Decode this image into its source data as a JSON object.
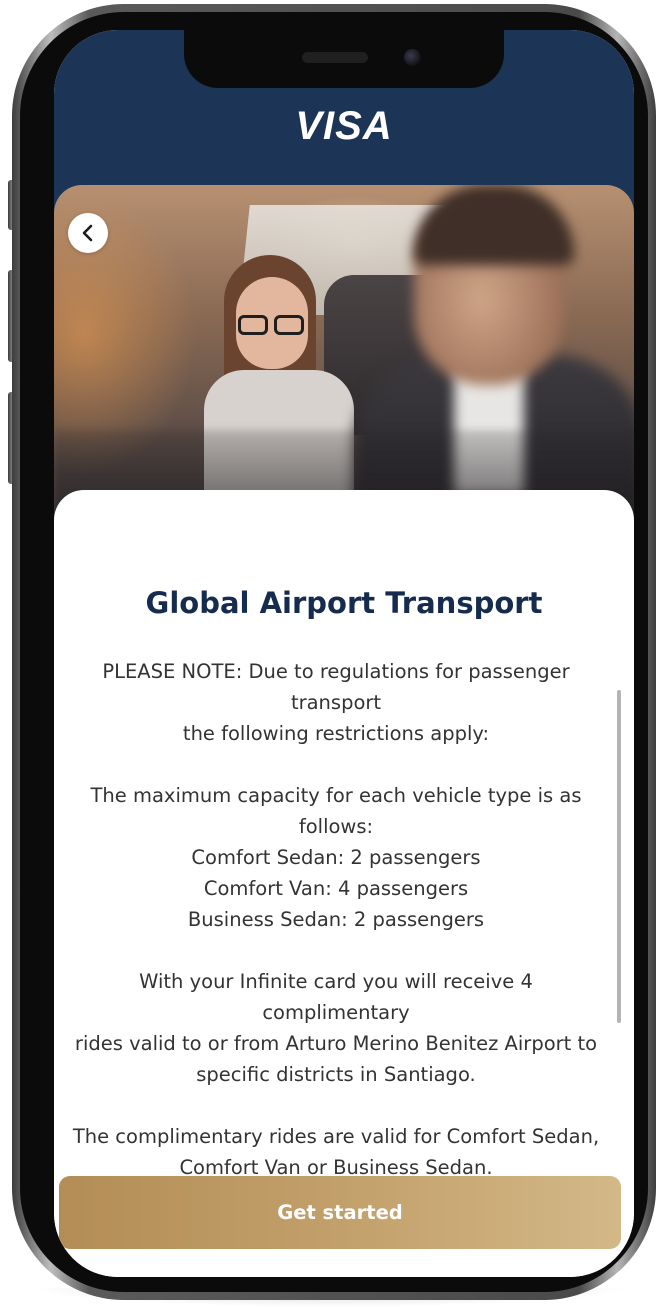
{
  "header": {
    "logo": "VISA",
    "brand_color": "#1c3557"
  },
  "hero": {
    "back_icon": "chevron-left-icon"
  },
  "content": {
    "title": "Global Airport Transport",
    "notice": [
      "PLEASE NOTE: Due to regulations for passenger transport",
      "the following restrictions apply:"
    ],
    "capacity": [
      "The maximum capacity for each vehicle type is as follows:",
      "Comfort Sedan: 2 passengers",
      "Comfort Van: 4 passengers",
      "Business Sedan: 2 passengers"
    ],
    "rides": [
      "With your Infinite card you will receive 4 complimentary",
      "rides valid to or from Arturo Merino Benitez Airport to",
      "specific districts in Santiago."
    ],
    "validity": [
      "The complimentary rides are valid for Comfort Sedan,",
      "Comfort Van or Business Sedan."
    ]
  },
  "cta": {
    "label": "Get started",
    "color": "#c4a26d"
  }
}
